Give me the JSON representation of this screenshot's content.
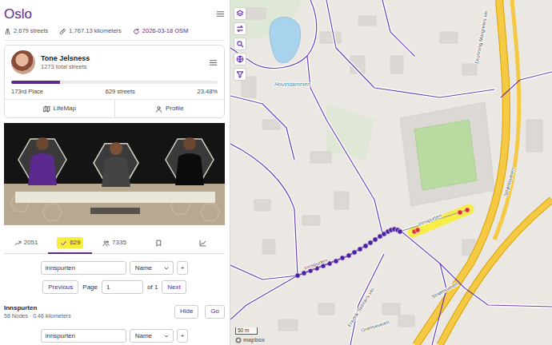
{
  "city": {
    "title": "Oslo",
    "streets": "2,679 streets",
    "distance": "1,767.13 kilometers",
    "updated": "2026-03-18 OSM"
  },
  "user": {
    "name": "Tone Jelsness",
    "total": "1273 total streets",
    "rank": "173rd Place",
    "streets": "629 streets",
    "percent": "23.48%",
    "level": 0.2348
  },
  "links": [
    {
      "label": "LifeMap",
      "kind": "map"
    },
    {
      "label": "Profile",
      "kind": "person"
    }
  ],
  "tabs": [
    {
      "label": "2051",
      "kind": "trend",
      "selected": false,
      "highlighted": false
    },
    {
      "label": "629",
      "kind": "check",
      "selected": true,
      "highlighted": true
    },
    {
      "label": "7335",
      "kind": "people",
      "selected": false,
      "highlighted": false
    },
    {
      "kind": "bookmark",
      "selected": false,
      "highlighted": false
    },
    {
      "kind": "chart",
      "selected": false,
      "highlighted": false
    }
  ],
  "search": {
    "value": "innspurten",
    "sort": "Name",
    "add": "+"
  },
  "pagination": {
    "previous": "Previous",
    "page_label": "Page",
    "page": "1",
    "of": "of 1",
    "next": "Next"
  },
  "results": [
    {
      "name": "Innspurten",
      "details": "58 Nodes · 0.46 kilometers",
      "hide": "Hide",
      "go": "Go"
    }
  ],
  "search_footer": {
    "value": "innspurten",
    "sort": "Name",
    "add": "+"
  },
  "map": {
    "labels": [
      {
        "text": "Hovindammen",
        "kind": "water"
      },
      {
        "text": "Innspurten",
        "kind": "street"
      },
      {
        "text": "Innspurten",
        "kind": "street"
      },
      {
        "text": "Grenseveien",
        "kind": "street"
      },
      {
        "text": "Fredrik Selmers vei",
        "kind": "street"
      },
      {
        "text": "Strømsveien",
        "kind": "street"
      },
      {
        "text": "Strømsveien",
        "kind": "street"
      },
      {
        "text": "Dronning Margretes vei",
        "kind": "street"
      }
    ],
    "nodes": [
      {
        "visited": true
      },
      {
        "visited": true
      },
      {
        "visited": true
      },
      {
        "visited": true
      },
      {
        "visited": true
      },
      {
        "visited": true
      },
      {
        "visited": true
      },
      {
        "visited": true
      },
      {
        "visited": true
      },
      {
        "visited": true
      },
      {
        "visited": true
      },
      {
        "visited": true
      },
      {
        "visited": true
      },
      {
        "visited": true
      },
      {
        "visited": true
      },
      {
        "visited": true
      },
      {
        "visited": true
      },
      {
        "visited": true
      },
      {
        "visited": true
      },
      {
        "visited": true
      },
      {
        "visited": true
      },
      {
        "visited": false
      },
      {
        "visited": false
      },
      {
        "visited": false
      },
      {
        "visited": false
      }
    ],
    "scale": "50 m",
    "attribution": "mapbox"
  }
}
